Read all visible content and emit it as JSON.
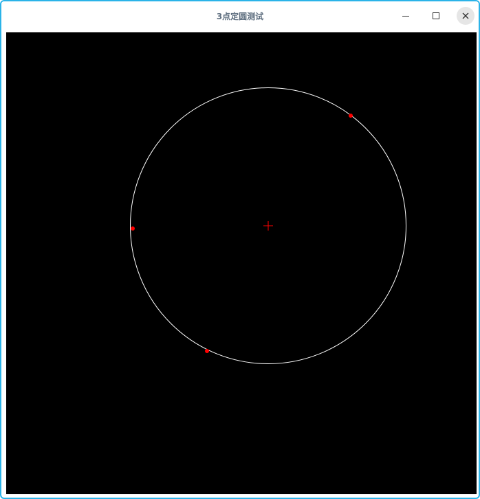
{
  "window": {
    "title": "3点定圆测试",
    "accent_color": "#2bb3e8",
    "controls": {
      "minimize_icon": "minimize-icon",
      "maximize_icon": "maximize-icon",
      "close_icon": "close-icon"
    }
  },
  "canvas": {
    "background_color": "#000000",
    "circle_color": "#ffffff",
    "point_color": "#ff0000",
    "center_marker_color": "#ff0000"
  }
}
